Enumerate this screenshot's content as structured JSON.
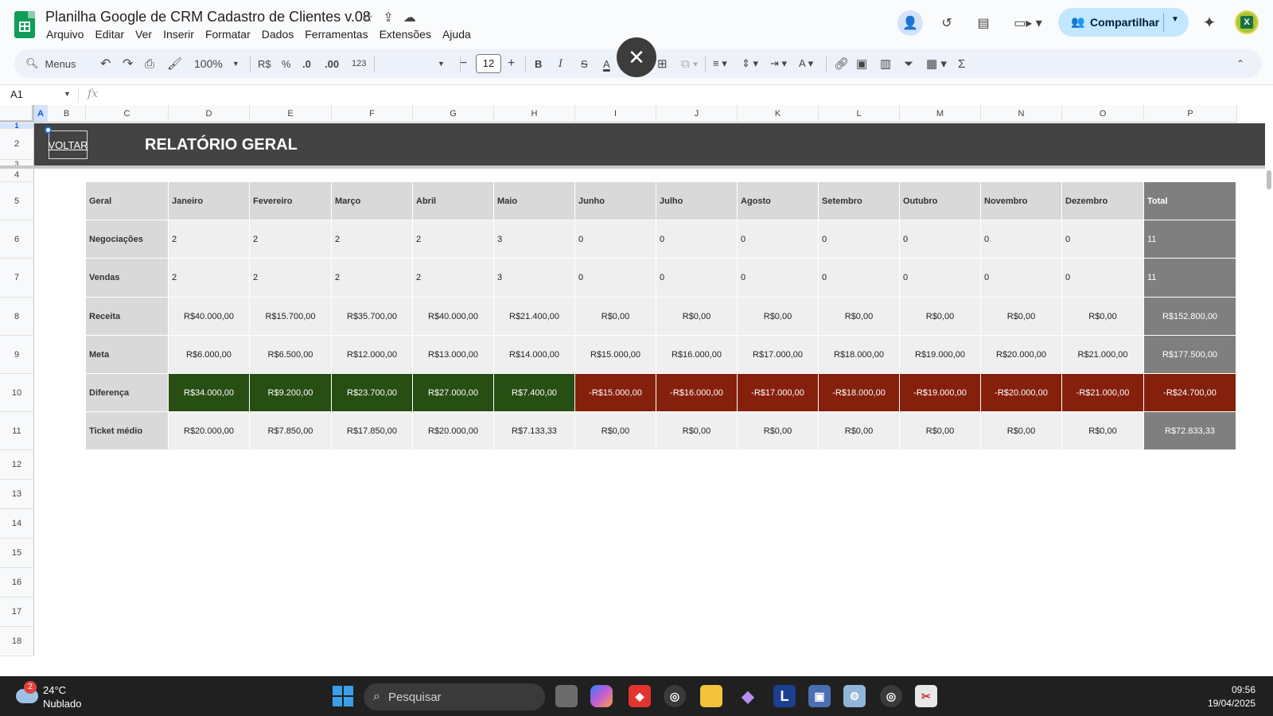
{
  "app": {
    "title": "Planilha Google de CRM Cadastro de Clientes v.08",
    "menu": [
      "Arquivo",
      "Editar",
      "Ver",
      "Inserir",
      "Formatar",
      "Dados",
      "Ferramentas",
      "Extensões",
      "Ajuda"
    ],
    "share_label": "Compartilhar"
  },
  "toolbar": {
    "search_label": "Menus",
    "zoom": "100%",
    "currency": "R$",
    "percent": "%",
    "dec_decrease": ".0",
    "dec_increase": ".00",
    "format_123": "123",
    "font_size": "12",
    "bold": "B",
    "italic": "I",
    "sum": "Σ"
  },
  "formula_bar": {
    "cell_ref": "A1",
    "fx": "fx"
  },
  "columns": [
    "A",
    "B",
    "C",
    "D",
    "E",
    "F",
    "G",
    "H",
    "I",
    "J",
    "K",
    "L",
    "M",
    "N",
    "O",
    "P"
  ],
  "rows": [
    "1",
    "2",
    "3",
    "4",
    "5",
    "6",
    "7",
    "8",
    "9",
    "10",
    "11",
    "12",
    "13",
    "14",
    "15",
    "16",
    "17",
    "18"
  ],
  "banner": {
    "back_link": "VOLTAR",
    "title": "RELATÓRIO GERAL"
  },
  "report": {
    "header": [
      "Geral",
      "Janeiro",
      "Fevereiro",
      "Março",
      "Abril",
      "Maio",
      "Junho",
      "Julho",
      "Agosto",
      "Setembro",
      "Outubro",
      "Novembro",
      "Dezembro",
      "Total"
    ],
    "rows": [
      {
        "label": "Negociações",
        "values": [
          "2",
          "2",
          "2",
          "2",
          "3",
          "0",
          "0",
          "0",
          "0",
          "0",
          "0",
          "0"
        ],
        "total": "11"
      },
      {
        "label": "Vendas",
        "values": [
          "2",
          "2",
          "2",
          "2",
          "3",
          "0",
          "0",
          "0",
          "0",
          "0",
          "0",
          "0"
        ],
        "total": "11"
      },
      {
        "label": "Receita",
        "values": [
          "R$40.000,00",
          "R$15.700,00",
          "R$35.700,00",
          "R$40.000,00",
          "R$21.400,00",
          "R$0,00",
          "R$0,00",
          "R$0,00",
          "R$0,00",
          "R$0,00",
          "R$0,00",
          "R$0,00"
        ],
        "total": "R$152.800,00"
      },
      {
        "label": "Meta",
        "values": [
          "R$6.000,00",
          "R$6.500,00",
          "R$12.000,00",
          "R$13.000,00",
          "R$14.000,00",
          "R$15.000,00",
          "R$16.000,00",
          "R$17.000,00",
          "R$18.000,00",
          "R$19.000,00",
          "R$20.000,00",
          "R$21.000,00"
        ],
        "total": "R$177.500,00"
      },
      {
        "label": "Diferença",
        "values": [
          "R$34.000,00",
          "R$9.200,00",
          "R$23.700,00",
          "R$27.000,00",
          "R$7.400,00",
          "-R$15.000,00",
          "-R$16.000,00",
          "-R$17.000,00",
          "-R$18.000,00",
          "-R$19.000,00",
          "-R$20.000,00",
          "-R$21.000,00"
        ],
        "total": "-R$24.700,00"
      },
      {
        "label": "Ticket médio",
        "values": [
          "R$20.000,00",
          "R$7.850,00",
          "R$17.850,00",
          "R$20.000,00",
          "R$7.133,33",
          "R$0,00",
          "R$0,00",
          "R$0,00",
          "R$0,00",
          "R$0,00",
          "R$0,00",
          "R$0,00"
        ],
        "total": "R$72.833,33"
      }
    ]
  },
  "colors": {
    "banner": "#434343",
    "header_cell": "#d9d9d9",
    "body_cell": "#efefef",
    "total_cell": "#7f7f7f",
    "positive": "#274e13",
    "negative": "#85200c"
  },
  "taskbar": {
    "weather_badge": "2",
    "temperature": "24°C",
    "condition": "Nublado",
    "search_placeholder": "Pesquisar",
    "time": "09:56",
    "date": "19/04/2025"
  }
}
